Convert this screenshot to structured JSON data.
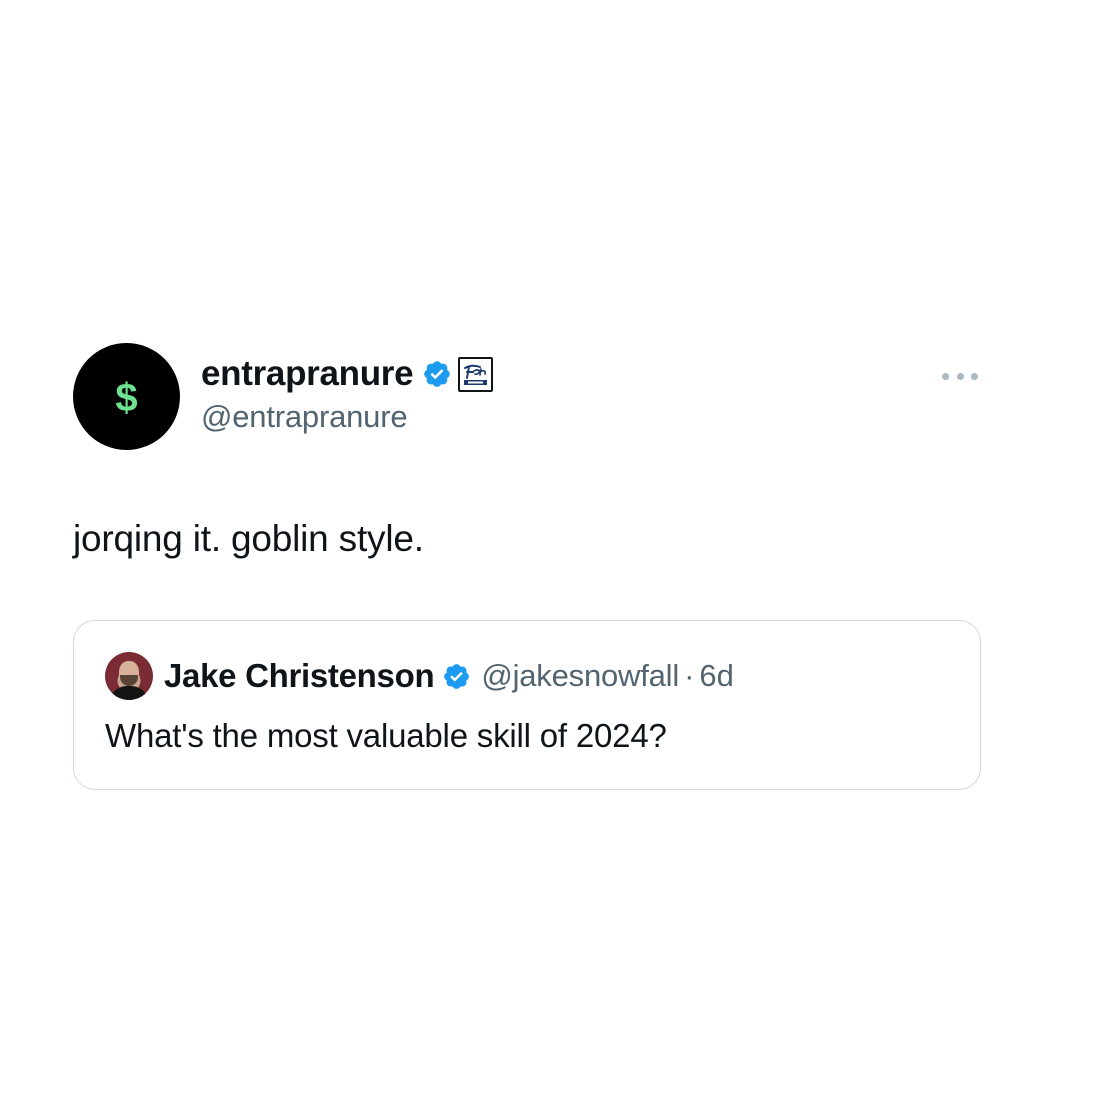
{
  "tweet": {
    "avatar_icon": "dollar-sign-icon",
    "avatar_glyph": "$",
    "display_name": "entrapranure",
    "verified_icon": "verified-badge-icon",
    "affiliate_icon": "affiliate-logo-icon",
    "handle": "@entrapranure",
    "more_icon": "more-options-icon",
    "text": "jorqing it. goblin style."
  },
  "quoted_tweet": {
    "avatar_icon": "user-avatar",
    "display_name": "Jake Christenson",
    "verified_icon": "verified-badge-icon",
    "handle": "@jakesnowfall",
    "separator": "·",
    "time": "6d",
    "text": "What's the most valuable skill of 2024?"
  },
  "colors": {
    "verified_blue": "#1d9bf0",
    "avatar_bg": "#000000",
    "dollar_green": "#6fe08f",
    "secondary_text": "#536471",
    "border": "#cfd9de"
  }
}
